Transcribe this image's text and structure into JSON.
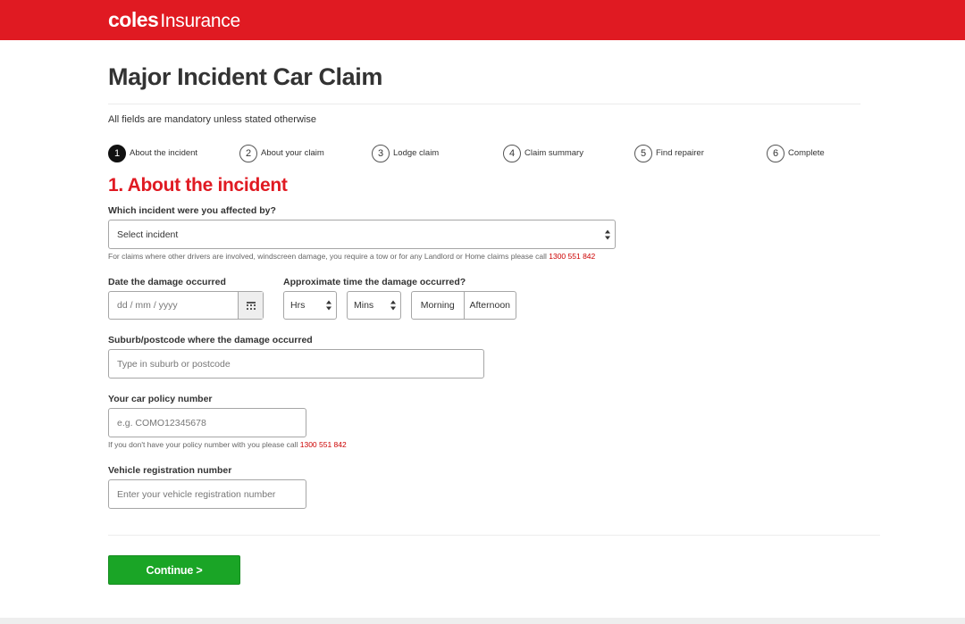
{
  "brand": {
    "name_bold": "coles",
    "name_rest": "Insurance",
    "color": "#e01a22"
  },
  "page": {
    "title": "Major Incident Car Claim",
    "mandatory_note": "All fields are mandatory unless stated otherwise"
  },
  "steps": [
    {
      "num": "1",
      "label": "About the incident",
      "active": true
    },
    {
      "num": "2",
      "label": "About your claim",
      "active": false
    },
    {
      "num": "3",
      "label": "Lodge claim",
      "active": false
    },
    {
      "num": "4",
      "label": "Claim summary",
      "active": false
    },
    {
      "num": "5",
      "label": "Find repairer",
      "active": false
    },
    {
      "num": "6",
      "label": "Complete",
      "active": false
    }
  ],
  "section": {
    "title": "1. About the incident"
  },
  "incident": {
    "label": "Which incident were you affected by?",
    "selected": "Select incident",
    "help_text": "For claims where other drivers are involved, windscreen damage, you require a tow or for any Landlord or Home claims please call",
    "help_phone": "1300 551 842"
  },
  "date": {
    "label": "Date the damage occurred",
    "placeholder": "dd / mm / yyyy",
    "icon": "calendar-icon"
  },
  "time": {
    "label": "Approximate time the damage occurred?",
    "hours_selected": "Hrs",
    "mins_selected": "Mins",
    "options": [
      "Morning",
      "Afternoon"
    ]
  },
  "suburb": {
    "label": "Suburb/postcode where the damage occurred",
    "placeholder": "Type in suburb or postcode"
  },
  "policy": {
    "label": "Your car policy number",
    "placeholder": "e.g. COMO12345678",
    "help_text": "If you don't have your policy number with you please call",
    "help_phone": "1300 551 842"
  },
  "rego": {
    "label": "Vehicle registration number",
    "placeholder": "Enter your vehicle registration number"
  },
  "actions": {
    "continue_label": "Continue >"
  },
  "colors": {
    "accent": "#e01a22",
    "continue": "#1aa526",
    "link": "#cc0000"
  }
}
